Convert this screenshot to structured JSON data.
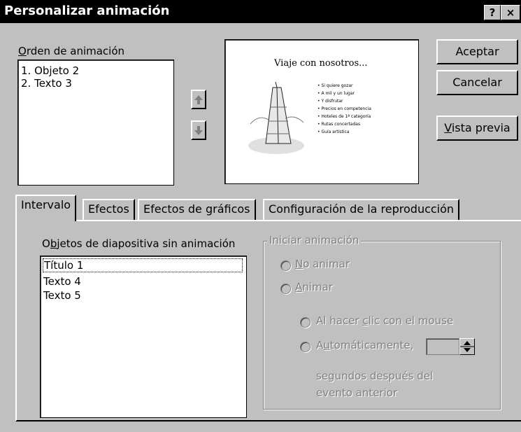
{
  "window": {
    "title": "Personalizar animación",
    "help_label": "?",
    "close_label": "×"
  },
  "order": {
    "label_mn": "O",
    "label_rest": "rden de animación",
    "items": [
      "1. Objeto 2",
      "2. Texto 3"
    ]
  },
  "preview_slide": {
    "title": "Viaje con nosotros...",
    "bullets": [
      "Si quiere gozar",
      "A mil y un lugar",
      "Y disfrutar",
      "Precios en competencia",
      "Hoteles de 1ª categoría",
      "Rutas concertadas",
      "Guía artística"
    ]
  },
  "buttons": {
    "ok": "Aceptar",
    "cancel": "Cancelar",
    "preview_mn": "V",
    "preview_rest": "ista previa"
  },
  "tabs": [
    "Intervalo",
    "Efectos",
    "Efectos de gráficos",
    "Configuración de la reproducción"
  ],
  "unanimated": {
    "label_pre": "O",
    "label_mn": "b",
    "label_rest": "jetos de diapositiva sin animación",
    "items": [
      "Título 1",
      "Texto 4",
      "Texto 5"
    ]
  },
  "start_animation": {
    "legend": "Iniciar animación",
    "no_animate_mn": "N",
    "no_animate_rest": "o animar",
    "animate_mn": "A",
    "animate_rest": "nimar",
    "on_click_pre": "Al hacer ",
    "on_click_mn": "c",
    "on_click_rest": "lic con el mouse",
    "auto_pre": "A",
    "auto_mn": "u",
    "auto_rest": "tomáticamente,",
    "seconds_value": "",
    "after_line1": "segundos después del",
    "after_line2": "evento anterior"
  },
  "colors": {
    "face": "#c0c0c0",
    "titlebar": "#000000",
    "disabled_text": "#808080"
  }
}
